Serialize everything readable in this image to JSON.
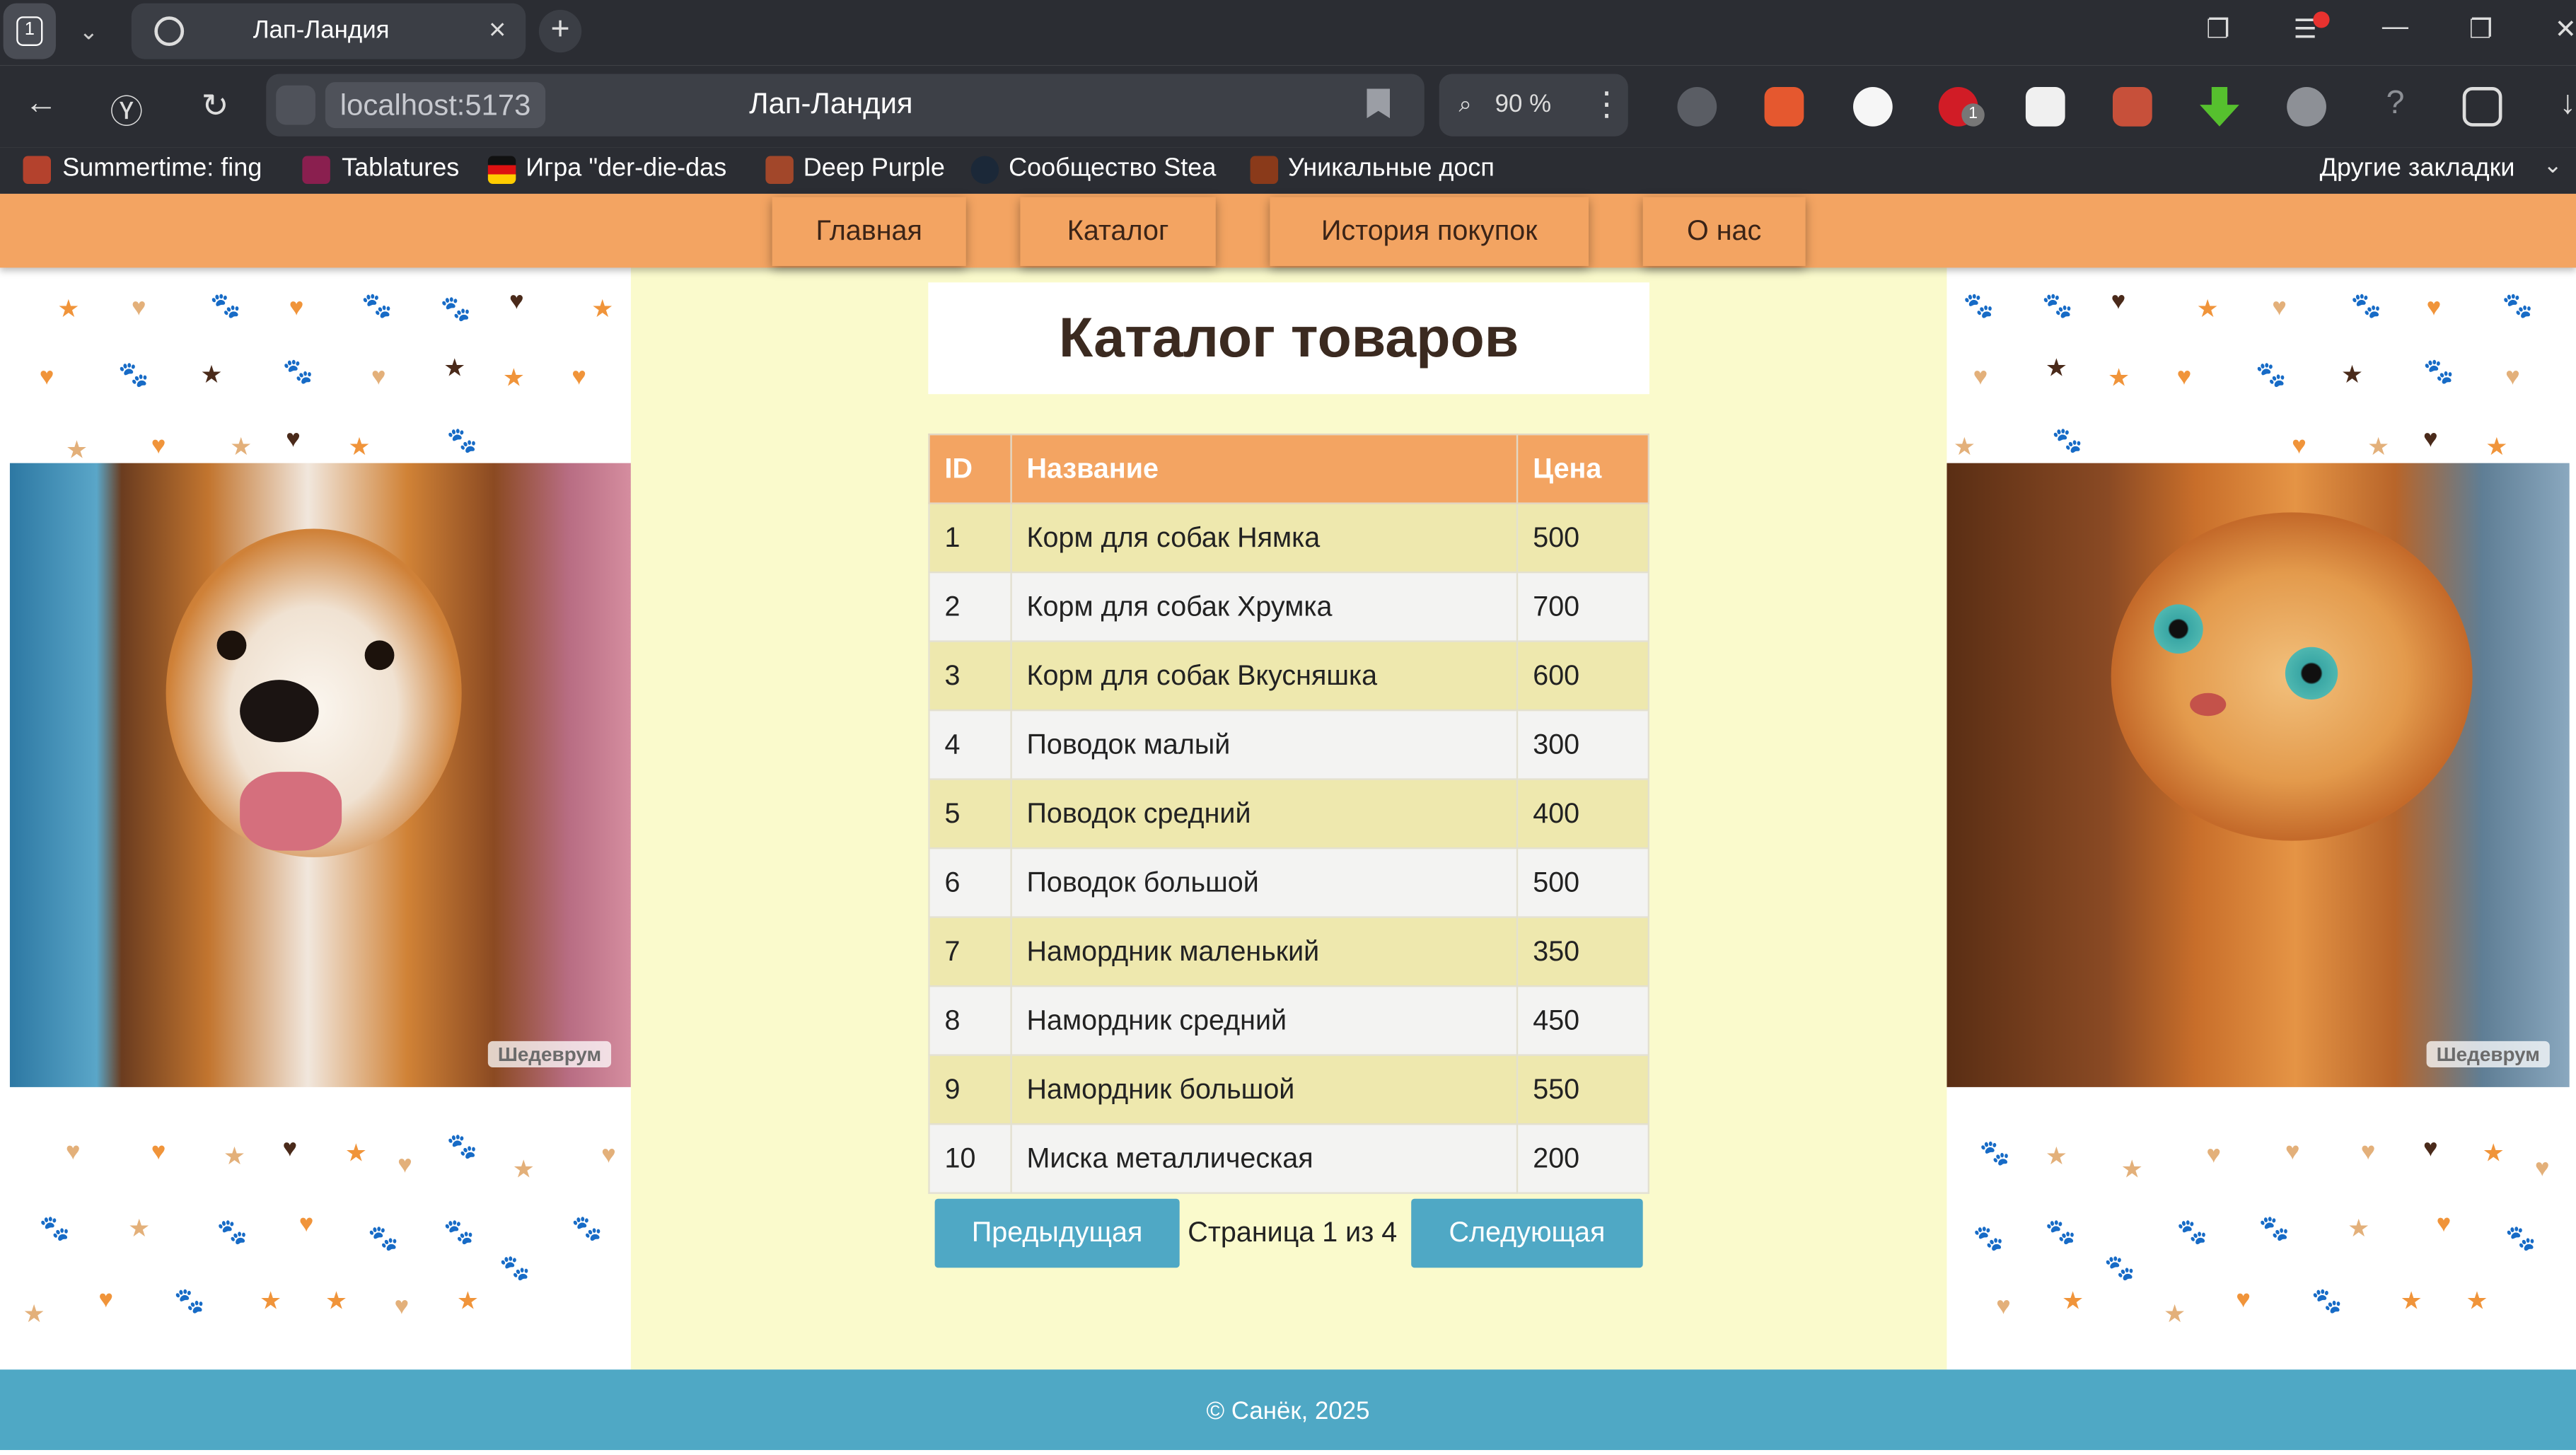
{
  "browser": {
    "tab_count": "1",
    "tab_title": "Лап-Ландия",
    "url_host": "localhost:5173",
    "page_title": "Лап-Ландия",
    "zoom": "90 %",
    "bookmarks": [
      "Summertime: fing",
      "Tablatures",
      "Игра \"der-die-das",
      "Deep Purple",
      "Сообщество Stea",
      "Уникальные досп"
    ],
    "other_bookmarks": "Другие закладки",
    "extension_badge": "1"
  },
  "nav": {
    "items": [
      "Главная",
      "Каталог",
      "История покупок",
      "О нас"
    ]
  },
  "catalog": {
    "title": "Каталог товаров",
    "columns": [
      "ID",
      "Название",
      "Цена"
    ],
    "rows": [
      [
        "1",
        "Корм для собак Нямка",
        "500"
      ],
      [
        "2",
        "Корм для собак Хрумка",
        "700"
      ],
      [
        "3",
        "Корм для собак Вкусняшка",
        "600"
      ],
      [
        "4",
        "Поводок малый",
        "300"
      ],
      [
        "5",
        "Поводок средний",
        "400"
      ],
      [
        "6",
        "Поводок большой",
        "500"
      ],
      [
        "7",
        "Намордник маленький",
        "350"
      ],
      [
        "8",
        "Намордник средний",
        "450"
      ],
      [
        "9",
        "Намордник большой",
        "550"
      ],
      [
        "10",
        "Миска металлическая",
        "200"
      ]
    ]
  },
  "pagination": {
    "prev": "Предыдущая",
    "status": "Страница 1 из 4",
    "next": "Следующая"
  },
  "images": {
    "watermark": "Шедеврум"
  },
  "footer": {
    "text": "© Санёк, 2025"
  },
  "colors": {
    "nav": "#f3a462",
    "content_bg": "#fafacc",
    "accent_blue": "#4fa8c5",
    "row_odd": "#eee8ae",
    "row_even": "#f3f3f2"
  }
}
